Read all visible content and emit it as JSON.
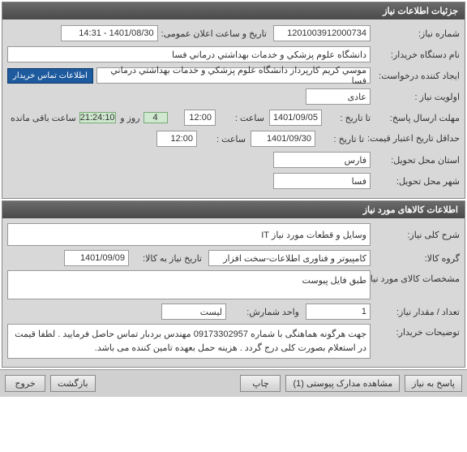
{
  "header1": "جزئیات اطلاعات نیاز",
  "need": {
    "number_label": "شماره نیاز:",
    "number": "1201003912000734",
    "announce_label": "تاریخ و ساعت اعلان عمومی:",
    "announce": "1401/08/30 - 14:31",
    "buyer_org_label": "نام دستگاه خریدار:",
    "buyer_org": "دانشگاه علوم پزشکي و خدمات بهداشتي درماني فسا",
    "creator_label": "ایجاد کننده درخواست:",
    "creator": "موسي كريم كارپرداز دانشگاه علوم پزشكي و خدمات بهداشتي درماني فسا",
    "contact_badge": "اطلاعات تماس خریدار",
    "priority_label": "اولویت نیاز :",
    "priority": "عادی",
    "deadline_reply_label": "مهلت ارسال پاسخ:",
    "to_date_label": "تا تاریخ :",
    "deadline_reply_date": "1401/09/05",
    "time_label": "ساعت :",
    "deadline_reply_time": "12:00",
    "remaining_days": "4",
    "days_and_label": "روز و",
    "remaining_time": "21:24:10",
    "remaining_suffix": "ساعت باقی مانده",
    "price_valid_label": "حداقل تاریخ اعتبار قیمت:",
    "price_valid_date": "1401/09/30",
    "price_valid_time": "12:00",
    "province_label": "استان محل تحویل:",
    "province": "فارس",
    "city_label": "شهر محل تحویل:",
    "city": "فسا"
  },
  "header2": "اطلاعات کالاهای مورد نیاز",
  "goods": {
    "desc_label": "شرح کلی نیاز:",
    "desc": "وسایل و قطعات مورد نیاز IT",
    "group_label": "گروه کالا:",
    "group": "کامپیوتر و فناوری اطلاعات-سخت افزار",
    "need_date_label": "تاریخ نیاز به کالا:",
    "need_date": "1401/09/09",
    "spec_label": "مشخصات کالای مورد نیاز:",
    "spec": "طبق فایل پیوست",
    "qty_label": "تعداد / مقدار نیاز:",
    "qty": "1",
    "unit_label": "واحد شمارش:",
    "unit": "لیست",
    "buyer_note_label": "توضیحات خریدار:",
    "buyer_note": "جهت هرگونه هماهنگی با شماره 09173302957 مهندس بردبار تماس حاصل فرمایید . لطفا قیمت در استعلام بصورت کلی درج گردد . هزینه حمل بعهده تامین کننده می باشد."
  },
  "footer": {
    "reply": "پاسخ به نیاز",
    "attachments": "مشاهده مدارک پیوستی (1)",
    "print": "چاپ",
    "back": "بازگشت",
    "exit": "خروج"
  }
}
